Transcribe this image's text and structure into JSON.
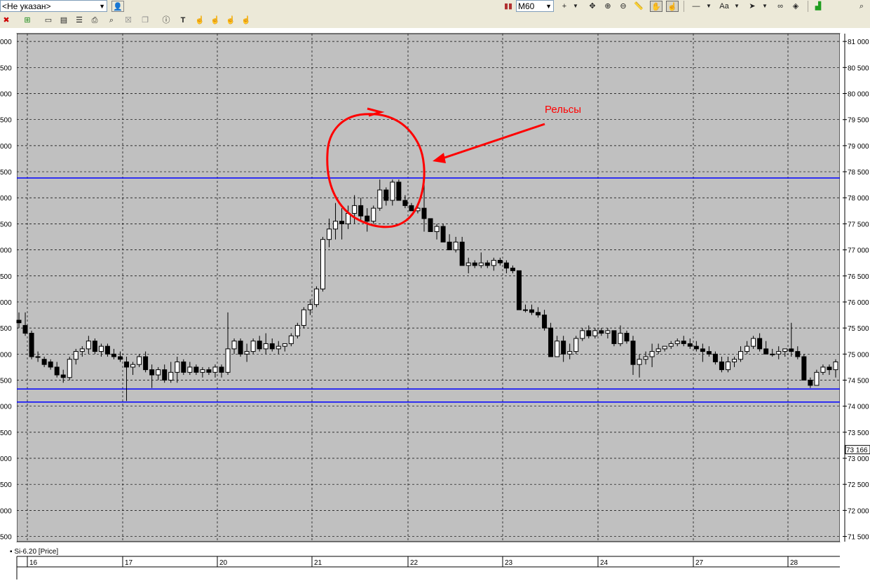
{
  "toolbar": {
    "account_select": "<Не указан>",
    "timeframe_select": "M60"
  },
  "annotation": {
    "label": "Рельсы",
    "color": "#ff0000"
  },
  "legend": {
    "instrument": "Si-6.20 [Price]"
  },
  "price_readout": "73 166",
  "colors": {
    "background": "#c0c0c0",
    "grid": "#000000",
    "level_lines": "#0000ff",
    "candle_up": "#ffffff",
    "candle_down": "#000000",
    "annotation": "#ff0000"
  },
  "chart_data": {
    "type": "candlestick",
    "title": "",
    "xlabel": "",
    "ylabel": "",
    "ylim": [
      71400,
      81150
    ],
    "y_ticks": [
      "81 000",
      "80 500",
      "80 000",
      "79 500",
      "79 000",
      "78 500",
      "78 000",
      "77 500",
      "77 000",
      "76 500",
      "76 000",
      "75 500",
      "75 000",
      "74 500",
      "74 000",
      "73 500",
      "73 000",
      "72 500",
      "72 000",
      "71 500"
    ],
    "y_tick_values": [
      81000,
      80500,
      80000,
      79500,
      79000,
      78500,
      78000,
      77500,
      77000,
      76500,
      76000,
      75500,
      75000,
      74500,
      74000,
      73500,
      73000,
      72500,
      72000,
      71500
    ],
    "left_ticks_partial": [
      "000",
      "500",
      "000",
      "500",
      "000",
      "500",
      "000",
      "500",
      "000",
      "500",
      "000",
      "500",
      "000",
      "500",
      "000",
      "500",
      "000",
      "500",
      "000",
      "500"
    ],
    "x_labels": [
      "16",
      "17",
      "20",
      "21",
      "22",
      "23",
      "24",
      "27",
      "28"
    ],
    "horizontal_levels": [
      78380,
      74330,
      74080
    ],
    "grid": true,
    "candles": [
      [
        75650,
        75800,
        75500,
        75600
      ],
      [
        75550,
        75800,
        75350,
        75400
      ],
      [
        75400,
        75450,
        74900,
        74950
      ],
      [
        74950,
        75050,
        74850,
        74950
      ],
      [
        74900,
        74950,
        74750,
        74800
      ],
      [
        74850,
        74900,
        74700,
        74750
      ],
      [
        74750,
        74850,
        74550,
        74600
      ],
      [
        74600,
        74700,
        74450,
        74550
      ],
      [
        74550,
        74950,
        74500,
        74900
      ],
      [
        74900,
        75100,
        74800,
        75050
      ],
      [
        75050,
        75150,
        74950,
        75100
      ],
      [
        75100,
        75350,
        75000,
        75250
      ],
      [
        75250,
        75300,
        75000,
        75050
      ],
      [
        75050,
        75200,
        74950,
        75150
      ],
      [
        75150,
        75200,
        74950,
        75000
      ],
      [
        75000,
        75100,
        74900,
        74950
      ],
      [
        74950,
        75050,
        74850,
        74900
      ],
      [
        74850,
        74950,
        74100,
        74750
      ],
      [
        74750,
        74850,
        74600,
        74800
      ],
      [
        74800,
        75000,
        74750,
        74950
      ],
      [
        74950,
        75050,
        74650,
        74700
      ],
      [
        74700,
        74800,
        74350,
        74600
      ],
      [
        74600,
        74750,
        74500,
        74700
      ],
      [
        74700,
        74800,
        74450,
        74500
      ],
      [
        74500,
        74850,
        74450,
        74650
      ],
      [
        74650,
        74950,
        74450,
        74850
      ],
      [
        74850,
        74900,
        74600,
        74650
      ],
      [
        74650,
        74850,
        74600,
        74750
      ],
      [
        74750,
        74800,
        74600,
        74650
      ],
      [
        74650,
        74750,
        74550,
        74700
      ],
      [
        74700,
        74750,
        74600,
        74650
      ],
      [
        74650,
        74800,
        74550,
        74750
      ],
      [
        74750,
        74800,
        74550,
        74650
      ],
      [
        74650,
        75800,
        74600,
        75100
      ],
      [
        75100,
        75300,
        75000,
        75250
      ],
      [
        75250,
        75300,
        74950,
        75000
      ],
      [
        75000,
        75200,
        74850,
        75050
      ],
      [
        75050,
        75300,
        75000,
        75250
      ],
      [
        75250,
        75350,
        75050,
        75100
      ],
      [
        75100,
        75400,
        75000,
        75200
      ],
      [
        75200,
        75300,
        75050,
        75100
      ],
      [
        75100,
        75250,
        75000,
        75150
      ],
      [
        75150,
        75200,
        75050,
        75200
      ],
      [
        75200,
        75400,
        75150,
        75350
      ],
      [
        75350,
        75600,
        75300,
        75550
      ],
      [
        75550,
        75900,
        75500,
        75850
      ],
      [
        75850,
        76050,
        75750,
        75950
      ],
      [
        75950,
        76300,
        75900,
        76250
      ],
      [
        76250,
        77250,
        76200,
        77200
      ],
      [
        77200,
        77600,
        77050,
        77400
      ],
      [
        77400,
        77900,
        77200,
        77550
      ],
      [
        77550,
        77800,
        77200,
        77500
      ],
      [
        77500,
        77850,
        77400,
        77700
      ],
      [
        77700,
        78050,
        77500,
        77850
      ],
      [
        77850,
        78000,
        77550,
        77650
      ],
      [
        77650,
        77800,
        77350,
        77550
      ],
      [
        77550,
        77850,
        77500,
        77800
      ],
      [
        77800,
        78350,
        77750,
        78150
      ],
      [
        78150,
        78200,
        77850,
        77950
      ],
      [
        77950,
        78350,
        77850,
        78300
      ],
      [
        78300,
        78350,
        77950,
        77950
      ],
      [
        77950,
        78050,
        77800,
        77850
      ],
      [
        77850,
        77900,
        77750,
        77750
      ],
      [
        77750,
        77900,
        77700,
        77800
      ],
      [
        77800,
        78400,
        77350,
        77600
      ],
      [
        77600,
        77600,
        77350,
        77350
      ],
      [
        77350,
        77500,
        77200,
        77450
      ],
      [
        77450,
        77500,
        77150,
        77150
      ],
      [
        77150,
        77300,
        77000,
        77000
      ],
      [
        77000,
        77250,
        76950,
        77150
      ],
      [
        77150,
        77250,
        76700,
        76700
      ],
      [
        76700,
        76850,
        76550,
        76750
      ],
      [
        76750,
        76800,
        76650,
        76700
      ],
      [
        76700,
        76950,
        76650,
        76750
      ],
      [
        76750,
        76800,
        76650,
        76700
      ],
      [
        76700,
        76850,
        76600,
        76800
      ],
      [
        76800,
        76850,
        76700,
        76750
      ],
      [
        76750,
        76800,
        76550,
        76650
      ],
      [
        76650,
        76700,
        76550,
        76600
      ],
      [
        76600,
        76600,
        75850,
        75850
      ],
      [
        75850,
        75950,
        75800,
        75850
      ],
      [
        75850,
        75950,
        75750,
        75800
      ],
      [
        75800,
        75900,
        75700,
        75750
      ],
      [
        75750,
        75850,
        75450,
        75500
      ],
      [
        75500,
        75600,
        74950,
        74950
      ],
      [
        74950,
        75350,
        74950,
        75250
      ],
      [
        75250,
        75350,
        74850,
        75000
      ],
      [
        75000,
        75200,
        74900,
        75050
      ],
      [
        75050,
        75350,
        75000,
        75300
      ],
      [
        75300,
        75500,
        75250,
        75450
      ],
      [
        75450,
        75550,
        75300,
        75350
      ],
      [
        75350,
        75500,
        75300,
        75450
      ],
      [
        75450,
        75500,
        75350,
        75400
      ],
      [
        75400,
        75500,
        75300,
        75450
      ],
      [
        75450,
        75450,
        75150,
        75200
      ],
      [
        75200,
        75550,
        75150,
        75400
      ],
      [
        75400,
        75450,
        75200,
        75250
      ],
      [
        75250,
        75350,
        74600,
        74800
      ],
      [
        74800,
        75000,
        74550,
        74900
      ],
      [
        74900,
        75050,
        74800,
        74950
      ],
      [
        74950,
        75200,
        74750,
        75050
      ],
      [
        75050,
        75200,
        75000,
        75100
      ],
      [
        75100,
        75150,
        75050,
        75150
      ],
      [
        75150,
        75250,
        75100,
        75200
      ],
      [
        75200,
        75300,
        75150,
        75250
      ],
      [
        75250,
        75350,
        75150,
        75200
      ],
      [
        75200,
        75300,
        75100,
        75150
      ],
      [
        75150,
        75250,
        75050,
        75100
      ],
      [
        75100,
        75200,
        74850,
        75050
      ],
      [
        75050,
        75150,
        74950,
        75000
      ],
      [
        75000,
        75050,
        74800,
        74850
      ],
      [
        74850,
        74950,
        74650,
        74700
      ],
      [
        74700,
        74950,
        74650,
        74850
      ],
      [
        74850,
        74950,
        74750,
        74900
      ],
      [
        74900,
        75150,
        74850,
        75050
      ],
      [
        75050,
        75250,
        75000,
        75150
      ],
      [
        75150,
        75350,
        75100,
        75300
      ],
      [
        75300,
        75400,
        75050,
        75100
      ],
      [
        75100,
        75250,
        75000,
        75000
      ],
      [
        75000,
        75100,
        74950,
        75000
      ],
      [
        75000,
        75150,
        74900,
        75050
      ],
      [
        75050,
        75100,
        74950,
        75100
      ],
      [
        75100,
        75600,
        74950,
        75050
      ],
      [
        75050,
        75150,
        74900,
        74950
      ],
      [
        74950,
        75000,
        74500,
        74500
      ],
      [
        74500,
        74550,
        74350,
        74400
      ],
      [
        74400,
        74700,
        74400,
        74650
      ],
      [
        74650,
        74800,
        74600,
        74750
      ],
      [
        74750,
        74800,
        74600,
        74700
      ],
      [
        74700,
        74900,
        74550,
        74850
      ]
    ]
  }
}
